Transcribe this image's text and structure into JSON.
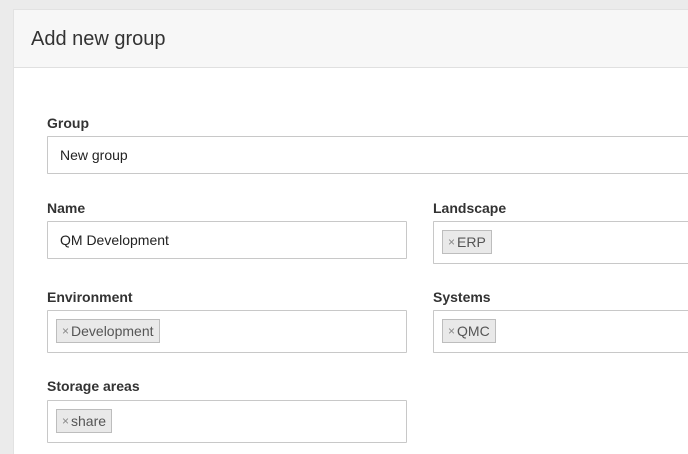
{
  "dialog": {
    "title": "Add new group"
  },
  "form": {
    "group": {
      "label": "Group",
      "value": "New group"
    },
    "name": {
      "label": "Name",
      "value": "QM Development"
    },
    "landscape": {
      "label": "Landscape",
      "tags": [
        "ERP"
      ]
    },
    "environment": {
      "label": "Environment",
      "tags": [
        "Development"
      ]
    },
    "systems": {
      "label": "Systems",
      "tags": [
        "QMC"
      ]
    },
    "storage_areas": {
      "label": "Storage areas",
      "tags": [
        "share"
      ]
    },
    "tag_remove_glyph": "×"
  }
}
